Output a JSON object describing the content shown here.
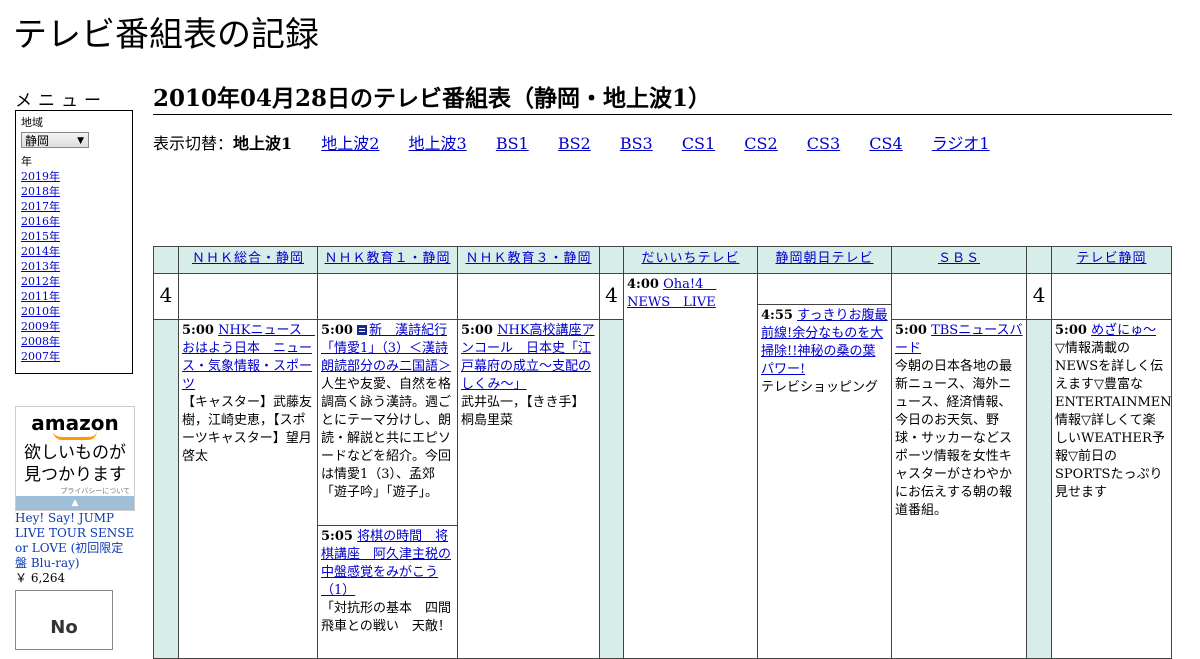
{
  "site_title": "テレビ番組表の記録",
  "menu": {
    "label": "メニュー",
    "region_label": "地域",
    "region_value": "静岡",
    "year_label": "年",
    "years": [
      "2019年",
      "2018年",
      "2017年",
      "2016年",
      "2015年",
      "2014年",
      "2013年",
      "2012年",
      "2011年",
      "2010年",
      "2009年",
      "2008年",
      "2007年"
    ]
  },
  "ad": {
    "logo": "amazon",
    "message_line1": "欲しいものが",
    "message_line2": "見つかります",
    "privacy": "プライバシーについて",
    "product_name": "Hey! Say! JUMP LIVE TOUR SENSE or LOVE (初回限定盤 Blu-ray)",
    "product_price": "￥ 6,264",
    "product_image_text": "No"
  },
  "page_title": "2010年04月28日のテレビ番組表（静岡・地上波1）",
  "switch": {
    "label": "表示切替：",
    "current": "地上波1",
    "links": [
      "地上波2",
      "地上波3",
      "BS1",
      "BS2",
      "BS3",
      "CS1",
      "CS2",
      "CS3",
      "CS4",
      "ラジオ1"
    ]
  },
  "hour": "4",
  "channels": [
    "ＮＨＫ総合・静岡",
    "ＮＨＫ教育１・静岡",
    "ＮＨＫ教育３・静岡",
    "だいいちテレビ",
    "静岡朝日テレビ",
    "ＳＢＳ",
    "テレビ静岡"
  ],
  "programs": {
    "nhk_sogo_1": {
      "time": "5:00",
      "title": "NHKニュース　おはよう日本　ニュース・気象情報・スポーツ",
      "desc": "【キャスター】武藤友樹，江崎史恵，【スポーツキャスター】望月啓太"
    },
    "nhk_edu1_1": {
      "time": "5:00",
      "title": "新　漢詩紀行「情愛1」（3）＜漢詩朗読部分のみ二国語＞",
      "desc": "人生や友愛、自然を格調高く詠う漢詩。週ごとにテーマ分けし、朗読・解説と共にエピソードなどを紹介。今回は情愛1（3）、孟郊「遊子吟」「遊子」。"
    },
    "nhk_edu1_2": {
      "time": "5:05",
      "title": "将棋の時間　将棋講座　阿久津主税の中盤感覚をみがこう（1）",
      "desc": "「対抗形の基本　四間飛車との戦い　天敵！"
    },
    "nhk_edu3_1": {
      "time": "5:00",
      "title": "NHK高校講座アンコール　日本史「江戸幕府の成立～支配のしくみ～」",
      "desc": "武井弘一，【きき手】桐島里菜"
    },
    "daiichi_1": {
      "time": "4:00",
      "title": "Oha!4　NEWS　LIVE",
      "desc": ""
    },
    "asahi_1": {
      "time": "4:55",
      "title": "すっきりお腹最前線!余分なものを大掃除!!神秘の桑の葉パワー!",
      "desc": "テレビショッピング"
    },
    "sbs_1": {
      "time": "5:00",
      "title": "TBSニュースバード",
      "desc": "今朝の日本各地の最新ニュース、海外ニュース、経済情報、今日のお天気、野球・サッカーなどスポーツ情報を女性キャスターがさわやかにお伝えする朝の報道番組。"
    },
    "tvs_1": {
      "time": "5:00",
      "title": "めざにゅ～",
      "desc": "▽情報満載のNEWSを詳しく伝えます▽豊富なENTERTAINMENT情報▽詳しくて楽しいWEATHER予報▽前日のSPORTSたっぷり見せます"
    }
  },
  "colors": {
    "header_bg": "#d6ede9",
    "link": "#0000cc"
  }
}
